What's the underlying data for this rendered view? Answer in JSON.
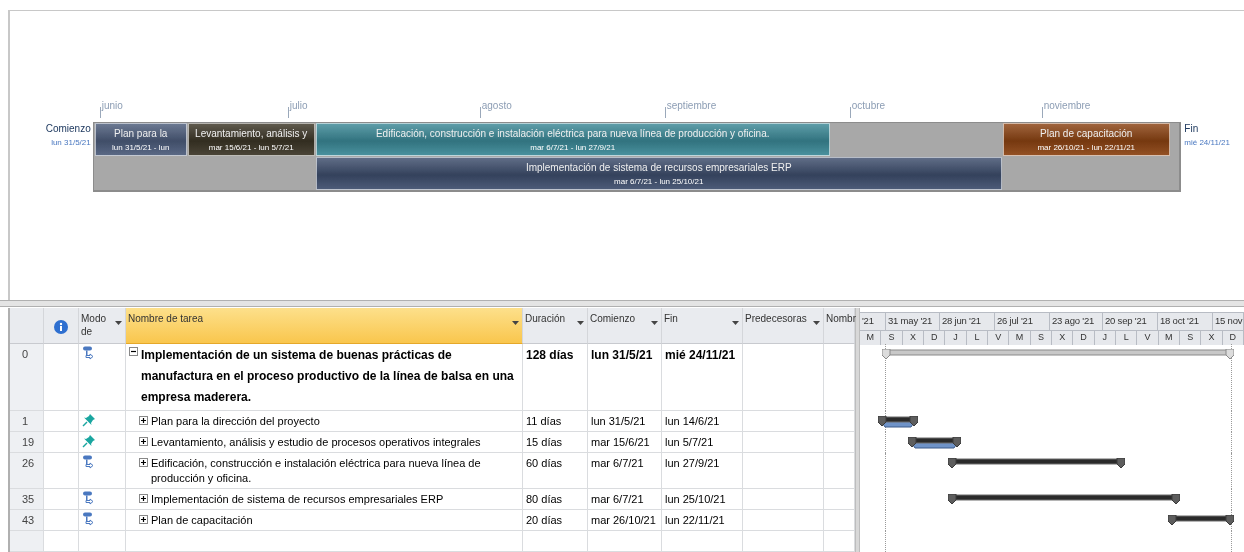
{
  "timeline": {
    "start_label": "Comienzo",
    "start_date": "lun 31/5/21",
    "end_label": "Fin",
    "end_date": "mié 24/11/21",
    "months": [
      "junio",
      "julio",
      "agosto",
      "septiembre",
      "octubre",
      "noviembre"
    ],
    "lanes": [
      {
        "bars": [
          {
            "name": "Plan para la",
            "dates": "lun 31/5/21 - lun",
            "color": "#4b5b7a"
          },
          {
            "name": "Levantamiento, análisis y",
            "dates": "mar 15/6/21 - lun 5/7/21",
            "color": "#3b3526"
          },
          {
            "name": "Edificación, construcción e instalación eléctrica para nueva línea de producción y oficina.",
            "dates": "mar 6/7/21 - lun 27/9/21",
            "color": "#3a8795"
          },
          {
            "name": "Plan de capacitación",
            "dates": "mar 26/10/21 - lun 22/11/21",
            "color": "#8a4212"
          }
        ]
      },
      {
        "bars": [
          {
            "name": "Implementación de sistema de recursos empresariales ERP",
            "dates": "mar 6/7/21 - lun 25/10/21",
            "color": "#3d4d6c"
          }
        ]
      }
    ]
  },
  "table": {
    "columns": [
      {
        "label": "Modo de",
        "selected": false,
        "dropdown": true
      },
      {
        "label": "Nombre de tarea",
        "selected": true,
        "dropdown": true
      },
      {
        "label": "Duración",
        "selected": false,
        "dropdown": true
      },
      {
        "label": "Comienzo",
        "selected": false,
        "dropdown": true
      },
      {
        "label": "Fin",
        "selected": false,
        "dropdown": true
      },
      {
        "label": "Predecesoras",
        "selected": false,
        "dropdown": true
      },
      {
        "label": "Nombr",
        "selected": false,
        "dropdown": false
      }
    ],
    "rows": [
      {
        "id": "0",
        "mode": {
          "kind": "auto"
        },
        "kind": "project",
        "expanded": true,
        "name": "Implementación de un sistema de buenas prácticas de manufactura en el proceso productivo de la línea de balsa en una empresa maderera.",
        "duration": "128 días",
        "start": "lun 31/5/21",
        "finish": "mié 24/11/21"
      },
      {
        "id": "1",
        "mode": {
          "kind": "manual"
        },
        "kind": "summary",
        "expanded": false,
        "name": "Plan para la dirección del proyecto",
        "duration": "11 días",
        "start": "lun 31/5/21",
        "finish": "lun 14/6/21"
      },
      {
        "id": "19",
        "mode": {
          "kind": "manual"
        },
        "kind": "summary",
        "expanded": false,
        "name": "Levantamiento, análisis y estudio de procesos operativos integrales",
        "duration": "15 días",
        "start": "mar 15/6/21",
        "finish": "lun 5/7/21"
      },
      {
        "id": "26",
        "mode": {
          "kind": "auto"
        },
        "kind": "summary",
        "expanded": false,
        "name": "Edificación, construcción e instalación eléctrica para nueva línea de producción y oficina.",
        "duration": "60 días",
        "start": "mar 6/7/21",
        "finish": "lun 27/9/21"
      },
      {
        "id": "35",
        "mode": {
          "kind": "auto"
        },
        "kind": "summary",
        "expanded": false,
        "name": "Implementación de sistema de recursos empresariales ERP",
        "duration": "80 días",
        "start": "mar 6/7/21",
        "finish": "lun 25/10/21"
      },
      {
        "id": "43",
        "mode": {
          "kind": "auto"
        },
        "kind": "summary",
        "expanded": false,
        "name": "Plan de capacitación",
        "duration": "20 días",
        "start": "mar 26/10/21",
        "finish": "lun 22/11/21"
      }
    ]
  },
  "gantt": {
    "periods": [
      "'21",
      "31 may '21",
      "28 jun '21",
      "26 jul '21",
      "23 ago '21",
      "20 sep '21",
      "18 oct '21",
      "15 nov"
    ],
    "days": [
      "M",
      "S",
      "X",
      "D",
      "J",
      "L",
      "V",
      "M",
      "S",
      "X",
      "D",
      "J",
      "L",
      "V",
      "M",
      "S",
      "X",
      "D"
    ]
  }
}
